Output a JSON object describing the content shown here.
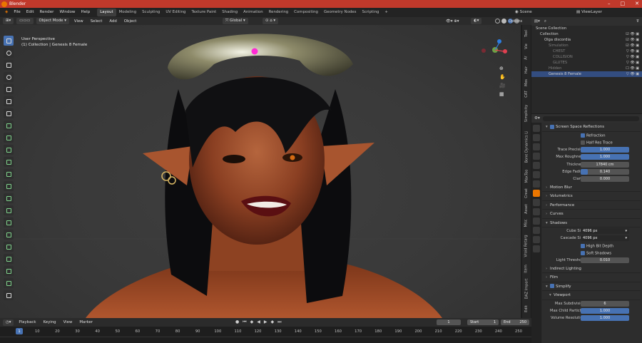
{
  "window": {
    "title": "Blender"
  },
  "menubar": {
    "menus": [
      "File",
      "Edit",
      "Render",
      "Window",
      "Help"
    ],
    "workspaces": [
      "Layout",
      "Modeling",
      "Sculpting",
      "UV Editing",
      "Texture Paint",
      "Shading",
      "Animation",
      "Rendering",
      "Compositing",
      "Geometry Nodes",
      "Scripting"
    ],
    "active_workspace": "Layout",
    "add_tab": "+",
    "scene_label": "Scene",
    "viewlayer_label": "ViewLayer"
  },
  "viewport_header": {
    "mode": "Object Mode",
    "menus": [
      "View",
      "Select",
      "Add",
      "Object"
    ],
    "orientation": "Global",
    "options": "Options"
  },
  "viewport": {
    "perspective": "User Perspective",
    "collection_info": "(1) Collection | Genesis 8 Female"
  },
  "sidebar_tabs": [
    "Tool",
    "Vie",
    "Ar",
    "Hair",
    "Mos",
    "CAT",
    "Simplicity",
    "Bone Dynamics Li",
    "MaxToo",
    "Creat",
    "Asset",
    "Misc",
    "Vroid Retarg",
    "Item",
    "DAZ Import",
    "Edit",
    "XP"
  ],
  "outliner": {
    "rows": [
      {
        "label": "Scene Collection",
        "indent": 1,
        "state": "normal",
        "vis": ""
      },
      {
        "label": "Collection",
        "indent": 2,
        "state": "normal",
        "vis": "☑ 👁 ▣"
      },
      {
        "label": "Olga discordia",
        "indent": 3,
        "state": "normal",
        "vis": "☑ 👁 ▣"
      },
      {
        "label": "Simulation",
        "indent": 4,
        "state": "dim",
        "vis": "☑ 👁 ▣"
      },
      {
        "label": "CHEST",
        "indent": 5,
        "state": "dim",
        "vis": "▽ 👁 ▣"
      },
      {
        "label": "COLLISION",
        "indent": 5,
        "state": "dim",
        "vis": "▽ 👁 ▣"
      },
      {
        "label": "GLUTES",
        "indent": 5,
        "state": "dim",
        "vis": "▽ 👁 ▣"
      },
      {
        "label": "Hidden",
        "indent": 4,
        "state": "dim",
        "vis": "☐ 👁 ▣"
      },
      {
        "label": "Genesis 8 Female",
        "indent": 4,
        "state": "sel",
        "vis": "▽ 👁 ▣"
      }
    ]
  },
  "properties": {
    "ssr": {
      "title": "Screen Space Reflections",
      "refraction": "Refraction",
      "half_res": "Half Res Trace",
      "fields": [
        {
          "label": "Trace Precision",
          "value": "1.000",
          "style": "blue"
        },
        {
          "label": "Max Roughness",
          "value": "1.000",
          "style": "blue"
        },
        {
          "label": "Thickness",
          "value": "17840 cm",
          "style": "plain"
        },
        {
          "label": "Edge Fading",
          "value": "0.140",
          "style": "bar",
          "fill": 0.14
        },
        {
          "label": "Clamp",
          "value": "0.000",
          "style": "plain"
        }
      ]
    },
    "collapsed_sections": [
      "Motion Blur",
      "Volumetrics",
      "Performance",
      "Curves"
    ],
    "shadows": {
      "title": "Shadows",
      "cube_label": "Cube Size",
      "cube_value": "4096 px",
      "cascade_label": "Cascade Size",
      "cascade_value": "4096 px",
      "high_bit": "High Bit Depth",
      "soft": "Soft Shadows",
      "light_label": "Light Threshold",
      "light_value": "0.010"
    },
    "collapsed_sections_2": [
      "Indirect Lighting",
      "Film"
    ],
    "simplify": {
      "title": "Simplify",
      "viewport": "Viewport",
      "fields": [
        {
          "label": "Max Subdivision",
          "value": "6",
          "style": "plain"
        },
        {
          "label": "Max Child Particles",
          "value": "1.000",
          "style": "blue"
        },
        {
          "label": "Volume Resolution",
          "value": "1.000",
          "style": "blue"
        }
      ]
    }
  },
  "timeline": {
    "menus": [
      "Playback",
      "Keying",
      "View",
      "Marker"
    ],
    "current_frame": "1",
    "start_label": "Start",
    "start_value": "1",
    "end_label": "End",
    "end_value": "250",
    "ticks": [
      "1",
      "10",
      "20",
      "30",
      "40",
      "50",
      "60",
      "70",
      "80",
      "90",
      "100",
      "110",
      "120",
      "130",
      "140",
      "150",
      "160",
      "170",
      "180",
      "190",
      "200",
      "210",
      "220",
      "230",
      "240",
      "250"
    ]
  }
}
